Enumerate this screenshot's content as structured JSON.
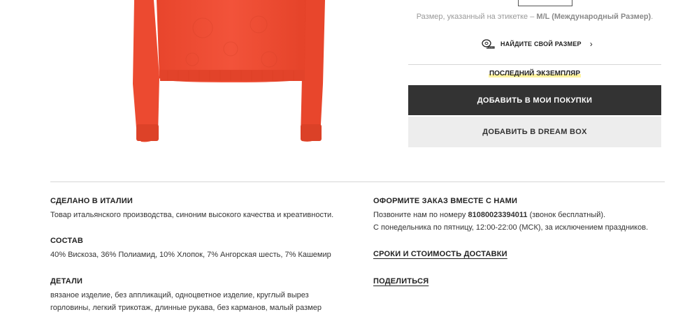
{
  "size_section": {
    "label_prefix": "Размер, указанный на этикетке –",
    "size_value": "M/L (Международный Размер)",
    "label_suffix": ".",
    "find_size_label": "НАЙДИТЕ СВОЙ РАЗМЕР",
    "find_size_icon": "measuring-tape-icon"
  },
  "stock_notice": "ПОСЛЕДНИЙ ЭКЗЕМПЛЯР",
  "actions": {
    "add_to_cart": "ДОБАВИТЬ В МОИ ПОКУПКИ",
    "add_to_dream_box": "ДОБАВИТЬ В DREAM BOX"
  },
  "product_info": {
    "made_in_title": "СДЕЛАНО В ИТАЛИИ",
    "made_in_text": "Товар итальянского производства, синоним высокого качества и креативности.",
    "composition_title": "СОСТАВ",
    "composition_text": "40% Вискоза, 36% Полиамид, 10% Хлопок, 7% Ангорская шесть, 7% Кашемир",
    "details_title": "ДЕТАЛИ",
    "details_line1": "вязаное изделие, без аппликаций, одноцветное изделие, круглый вырез",
    "details_line2": "горловины, легкий трикотаж, длинные рукава, без карманов, малый размер"
  },
  "order_info": {
    "title": "ОФОРМИТЕ ЗАКАЗ ВМЕСТЕ С НАМИ",
    "call_prefix": "Позвоните нам по номеру",
    "phone": "81080023394011",
    "call_suffix": "(звонок бесплатный).",
    "hours": "С понедельника по пятницу, 12:00-22:00 (МСК), за исключением праздников.",
    "delivery_link": "СРОКИ И СТОИМОСТЬ ДОСТАВКИ",
    "share_link": "ПОДЕЛИТЬСЯ"
  },
  "colors": {
    "sweater": "#f04a30",
    "button_dark": "#333333",
    "button_light": "#ededed",
    "highlight": "#fff3a0"
  }
}
